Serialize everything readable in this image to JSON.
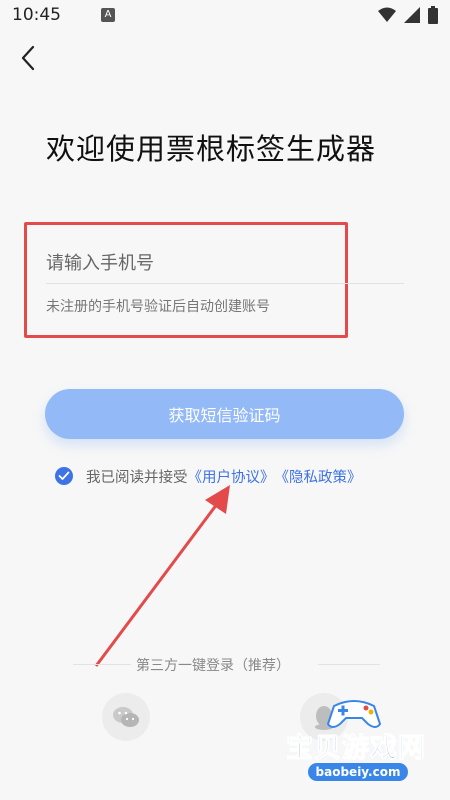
{
  "status_bar": {
    "time": "10:45",
    "notification_icon": "A"
  },
  "header": {
    "back_icon": "chevron-left-icon",
    "title": "欢迎使用票根标签生成器"
  },
  "form": {
    "phone_placeholder": "请输入手机号",
    "phone_value": "",
    "hint": "未注册的手机号验证后自动创建账号",
    "sms_button_label": "获取短信验证码"
  },
  "agreement": {
    "checked": true,
    "text": "我已阅读并接受",
    "user_agreement": "《用户协议》",
    "privacy_policy": "《隐私政策》"
  },
  "third_party": {
    "label": "第三方一键登录（推荐）",
    "wechat_icon": "wechat-icon",
    "qq_icon": "qq-icon"
  },
  "watermark": {
    "title": "宝贝游戏网",
    "url": "baobeiy.com"
  },
  "colors": {
    "accent": "#3d73e6",
    "button": "#93b9f7",
    "highlight": "#e34b4b"
  }
}
